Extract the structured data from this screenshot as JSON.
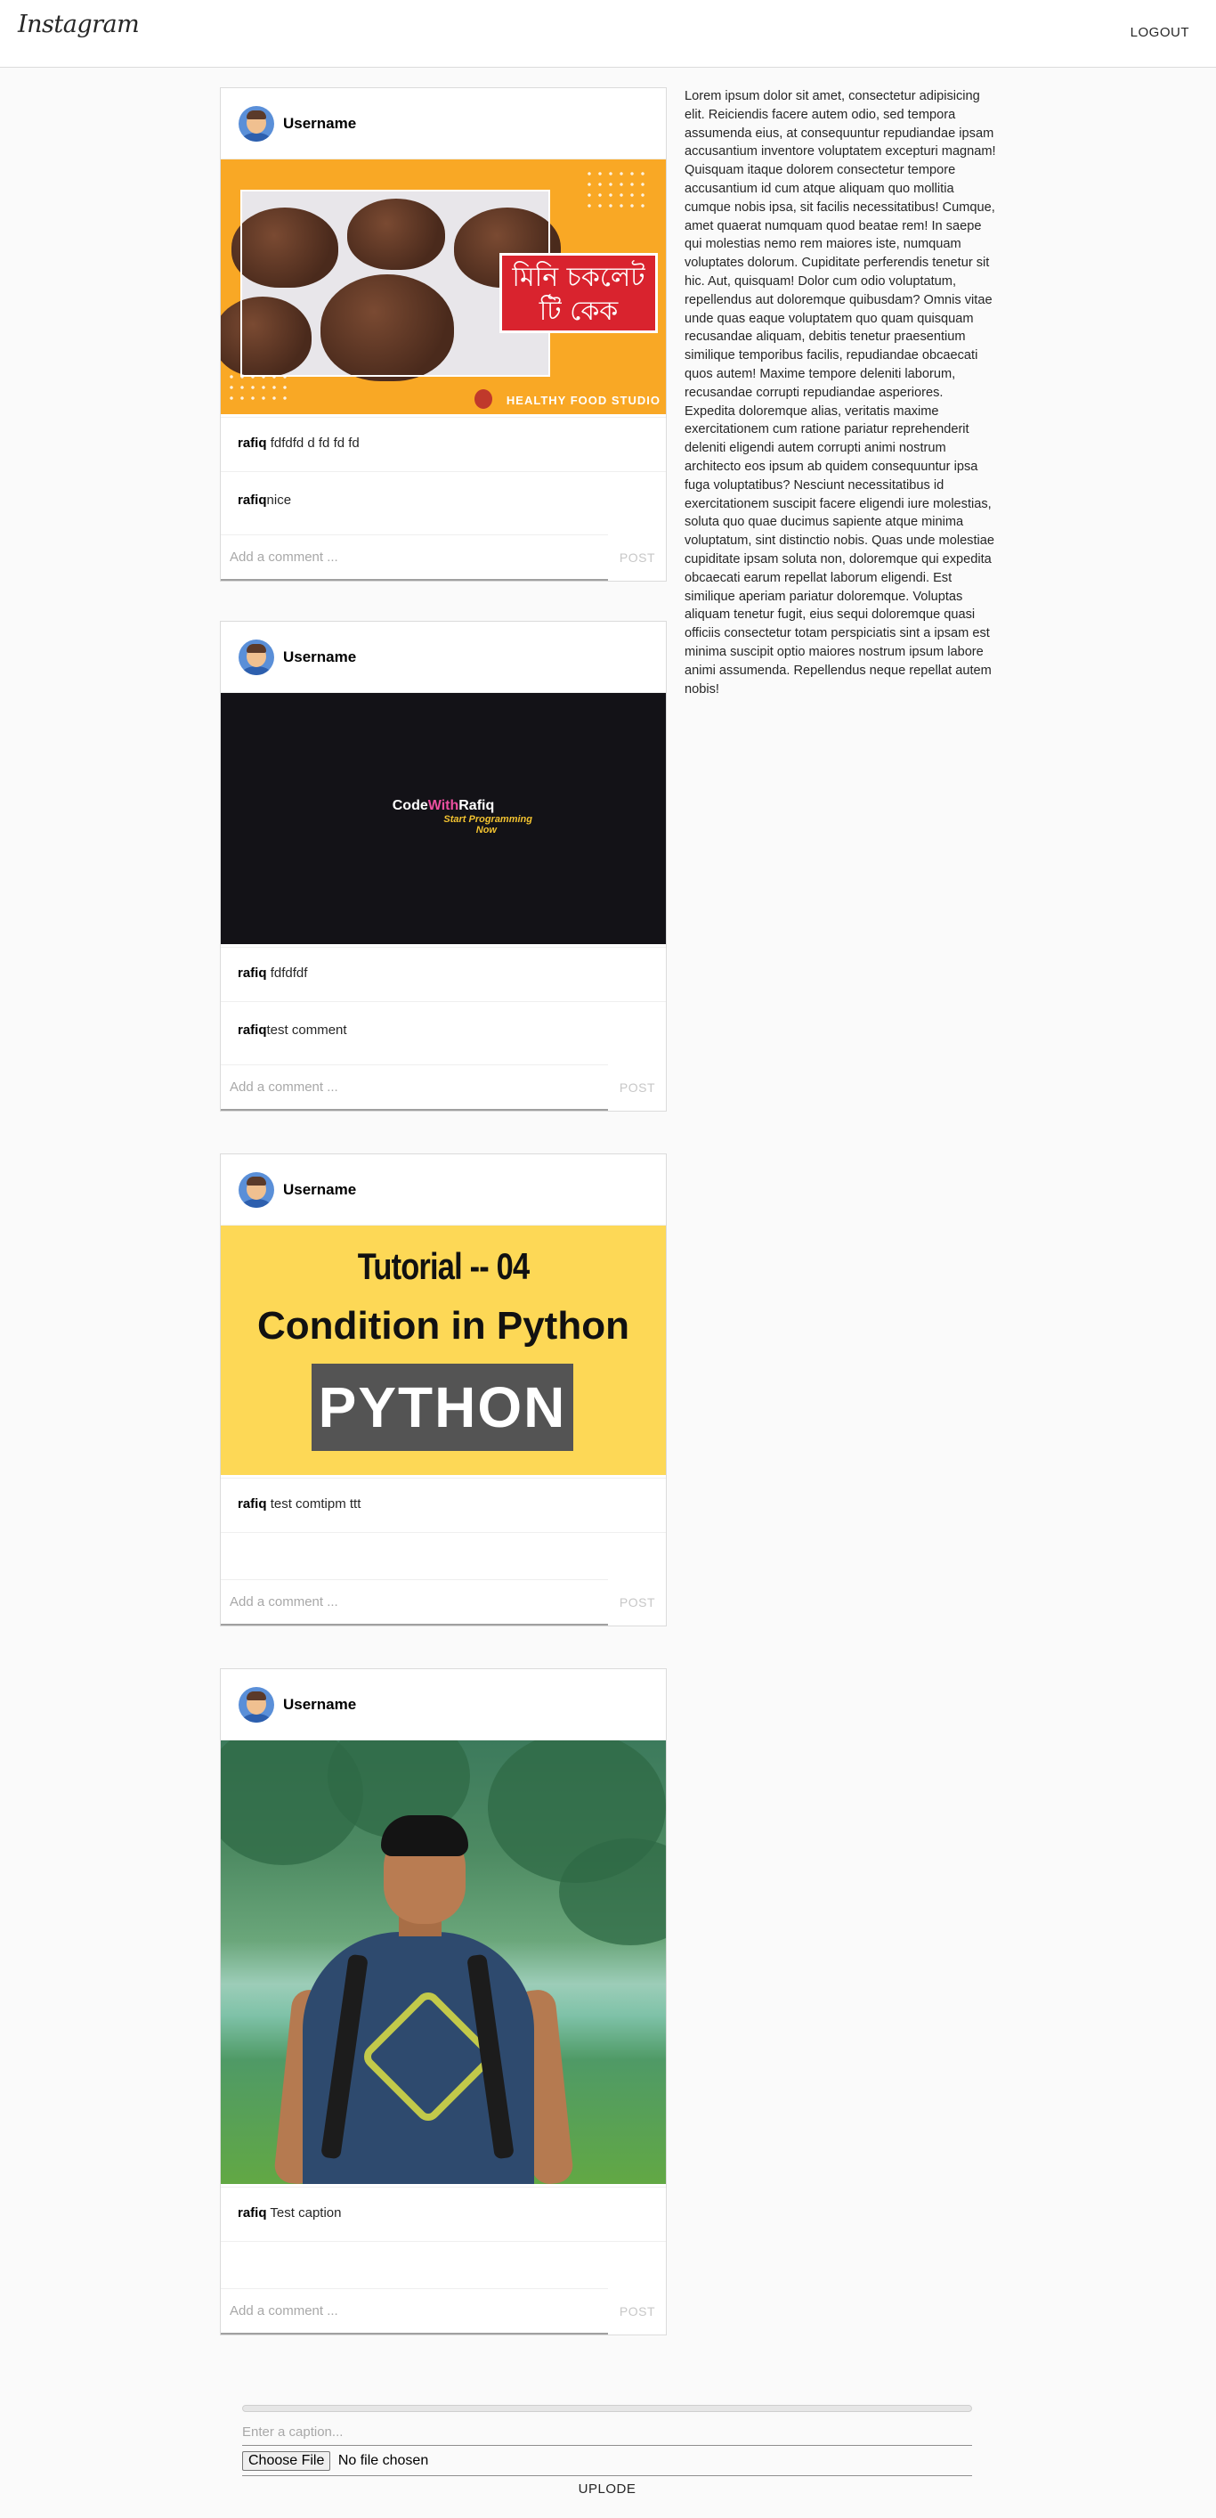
{
  "header": {
    "logo": "Instagram",
    "logout_label": "LOGOUT"
  },
  "posts": [
    {
      "username": "Username",
      "image": {
        "badge_line1": "মিনি চকলেট",
        "badge_line2": "টি কেক",
        "brand": "HEALTHY FOOD STUDIO"
      },
      "caption_user": "rafiq",
      "caption_text": "fdfdfd d fd fd fd",
      "comments": [
        {
          "user": "rafiq",
          "text": "nice"
        }
      ],
      "comment_placeholder": "Add a comment ...",
      "post_label": "POST"
    },
    {
      "username": "Username",
      "image": {
        "title_code": "Code",
        "title_with": "With",
        "title_rafiq": "Rafiq",
        "sub_line1": "Start Programming",
        "sub_line2": "Now"
      },
      "caption_user": "rafiq",
      "caption_text": "fdfdfdf",
      "comments": [
        {
          "user": "rafiq",
          "text": "test comment"
        }
      ],
      "comment_placeholder": "Add a comment ...",
      "post_label": "POST"
    },
    {
      "username": "Username",
      "image": {
        "line1": "Tutorial -- 04",
        "line2": "Condition in Python",
        "box": "PYTHON"
      },
      "caption_user": "rafiq",
      "caption_text": "test comtipm ttt",
      "comments": [],
      "comment_placeholder": "Add a comment ...",
      "post_label": "POST"
    },
    {
      "username": "Username",
      "image": {},
      "caption_user": "rafiq",
      "caption_text": "Test caption",
      "comments": [],
      "comment_placeholder": "Add a comment ...",
      "post_label": "POST"
    }
  ],
  "sidebar": {
    "text": "Lorem ipsum dolor sit amet, consectetur adipisicing elit. Reiciendis facere autem odio, sed tempora assumenda eius, at consequuntur repudiandae ipsam accusantium inventore voluptatem excepturi magnam! Quisquam itaque dolorem consectetur tempore accusantium id cum atque aliquam quo mollitia cumque nobis ipsa, sit facilis necessitatibus! Cumque, amet quaerat numquam quod beatae rem! In saepe qui molestias nemo rem maiores iste, numquam voluptates dolorum. Cupiditate perferendis tenetur sit hic. Aut, quisquam! Dolor cum odio voluptatum, repellendus aut doloremque quibusdam? Omnis vitae unde quas eaque voluptatem quo quam quisquam recusandae aliquam, debitis tenetur praesentium similique temporibus facilis, repudiandae obcaecati quos autem! Maxime tempore deleniti laborum, recusandae corrupti repudiandae asperiores. Expedita doloremque alias, veritatis maxime exercitationem cum ratione pariatur reprehenderit deleniti eligendi autem corrupti animi nostrum architecto eos ipsum ab quidem consequuntur ipsa fuga voluptatibus? Nesciunt necessitatibus id exercitationem suscipit facere eligendi iure molestias, soluta quo quae ducimus sapiente atque minima voluptatum, sint distinctio nobis. Quas unde molestiae cupiditate ipsam soluta non, doloremque qui expedita obcaecati earum repellat laborum eligendi. Est similique aperiam pariatur doloremque. Voluptas aliquam tenetur fugit, eius sequi doloremque quasi officiis consectetur totam perspiciatis sint a ipsam est minima suscipit optio maiores nostrum ipsum labore animi assumenda. Repellendus neque repellat autem nobis!"
  },
  "upload": {
    "progress_percent": 0,
    "caption_placeholder": "Enter a caption...",
    "file_button_label": "Choose File",
    "file_status": "No file chosen",
    "submit_label": "UPLODE"
  }
}
